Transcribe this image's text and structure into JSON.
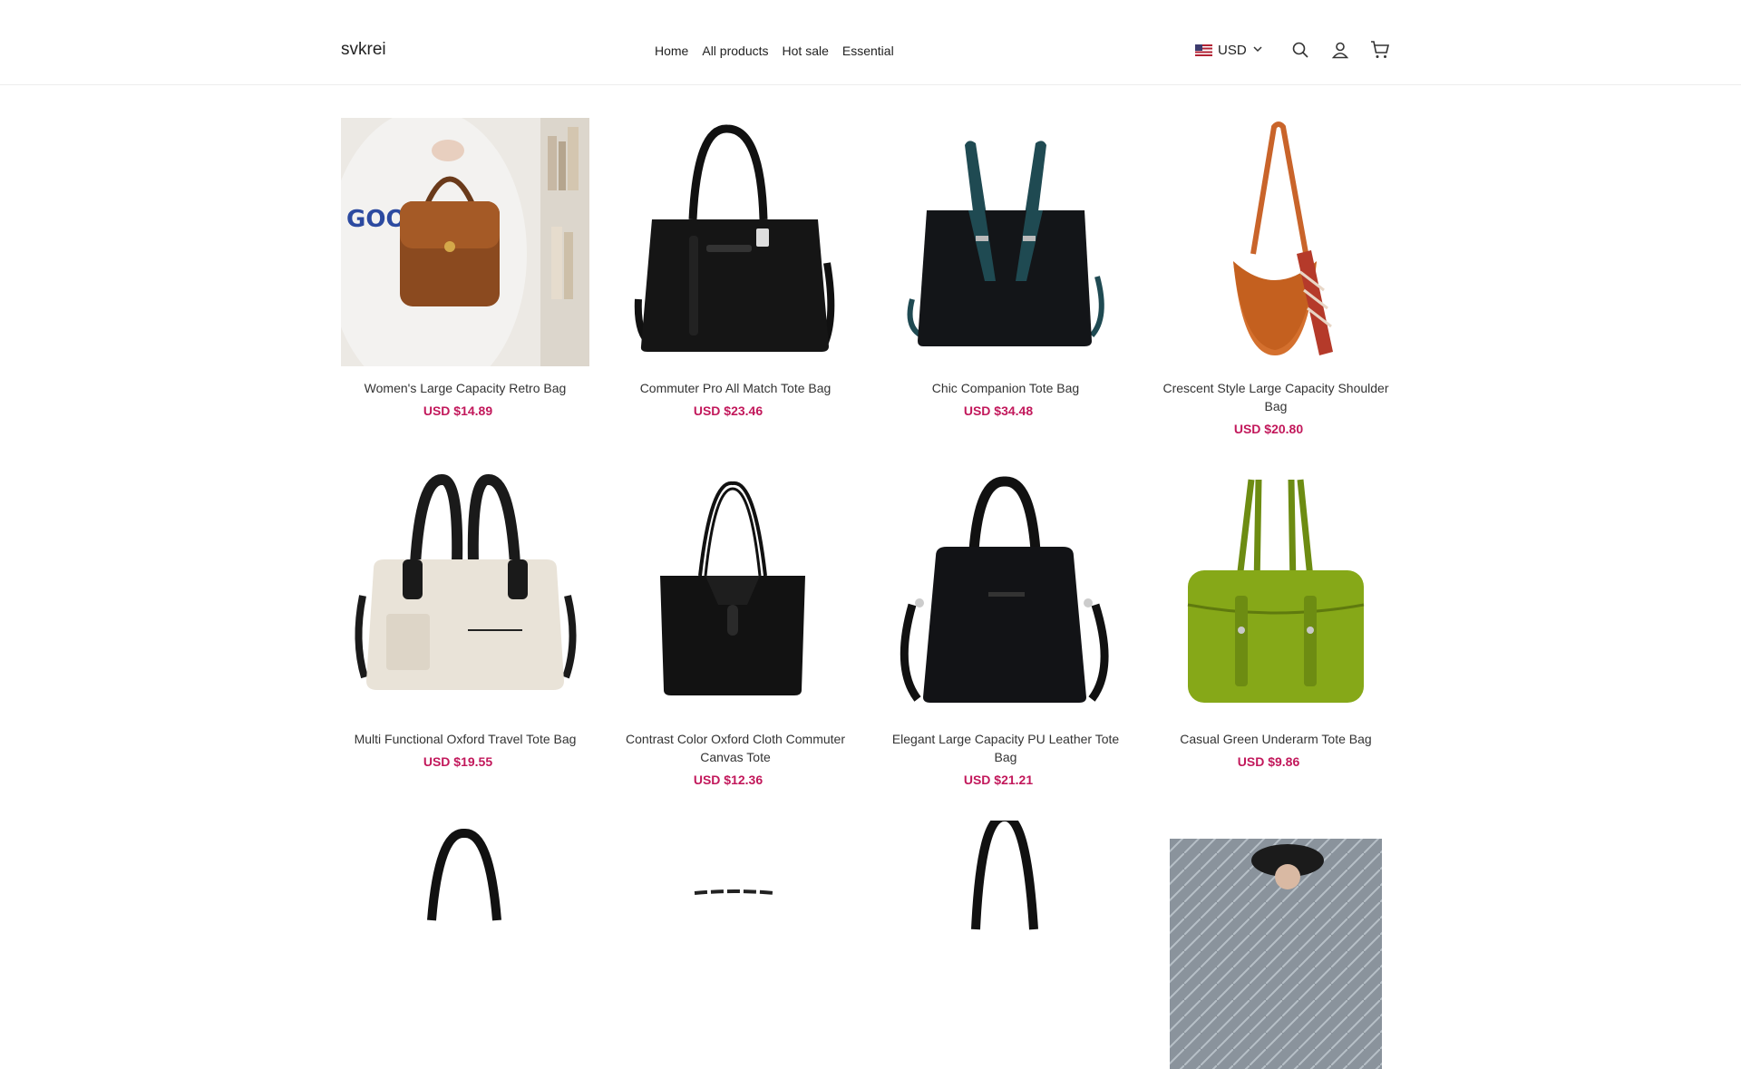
{
  "header": {
    "brand": "svkrei",
    "nav": [
      "Home",
      "All products",
      "Hot sale",
      "Essential"
    ],
    "currency": "USD",
    "icons": [
      "search-icon",
      "account-icon",
      "cart-icon"
    ]
  },
  "colors": {
    "price": "#c2185b",
    "text": "#333333",
    "border": "#ececec"
  },
  "products": [
    {
      "title": "Women's Large Capacity Retro Bag",
      "price": "USD $14.89",
      "image": "brown-retro-bag-photo"
    },
    {
      "title": "Commuter Pro All Match Tote Bag",
      "price": "USD $23.46",
      "image": "black-tote-bag"
    },
    {
      "title": "Chic Companion Tote Bag",
      "price": "USD $34.48",
      "image": "black-teal-tote-bag"
    },
    {
      "title": "Crescent Style Large Capacity Shoulder Bag",
      "price": "USD $20.80",
      "image": "orange-crescent-bag"
    },
    {
      "title": "Multi Functional Oxford Travel Tote Bag",
      "price": "USD $19.55",
      "image": "cream-travel-bag"
    },
    {
      "title": "Contrast Color Oxford Cloth Commuter Canvas Tote",
      "price": "USD $12.36",
      "image": "black-canvas-tote"
    },
    {
      "title": "Elegant Large Capacity PU Leather Tote Bag",
      "price": "USD $21.21",
      "image": "black-leather-tote"
    },
    {
      "title": "Casual Green Underarm Tote Bag",
      "price": "USD $9.86",
      "image": "green-underarm-bag"
    }
  ]
}
